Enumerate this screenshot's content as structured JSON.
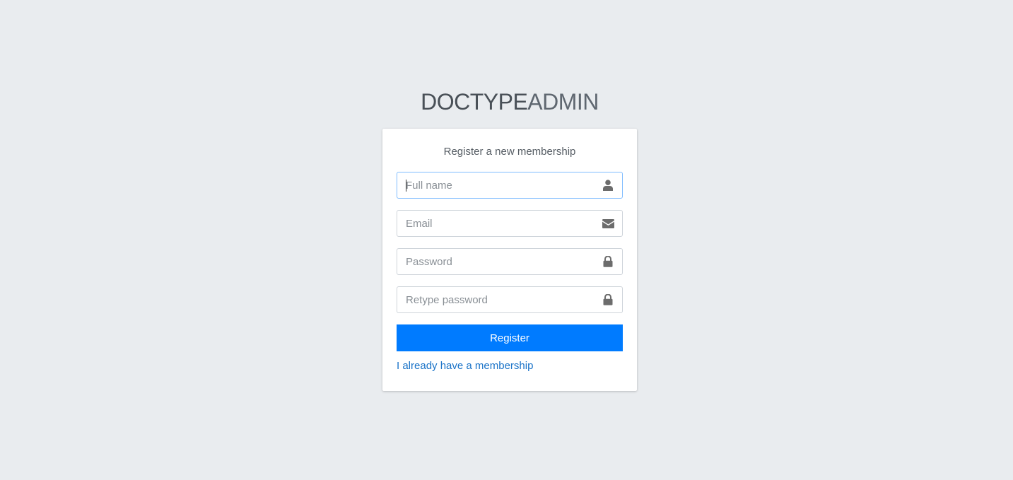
{
  "logo": {
    "bold": "DOCTYPE",
    "light": "ADMIN"
  },
  "card": {
    "message": "Register a new membership"
  },
  "form": {
    "full_name": {
      "value": "",
      "placeholder": "Full name",
      "icon": "user-icon"
    },
    "email": {
      "value": "",
      "placeholder": "Email",
      "icon": "envelope-icon"
    },
    "password": {
      "value": "",
      "placeholder": "Password",
      "icon": "lock-icon"
    },
    "retype_password": {
      "value": "",
      "placeholder": "Retype password",
      "icon": "lock-icon"
    },
    "submit_label": "Register",
    "login_link": "I already have a membership"
  },
  "colors": {
    "background": "#e9ecef",
    "primary": "#007bff",
    "link": "#1a73c8",
    "icon": "#6c6c6c"
  }
}
